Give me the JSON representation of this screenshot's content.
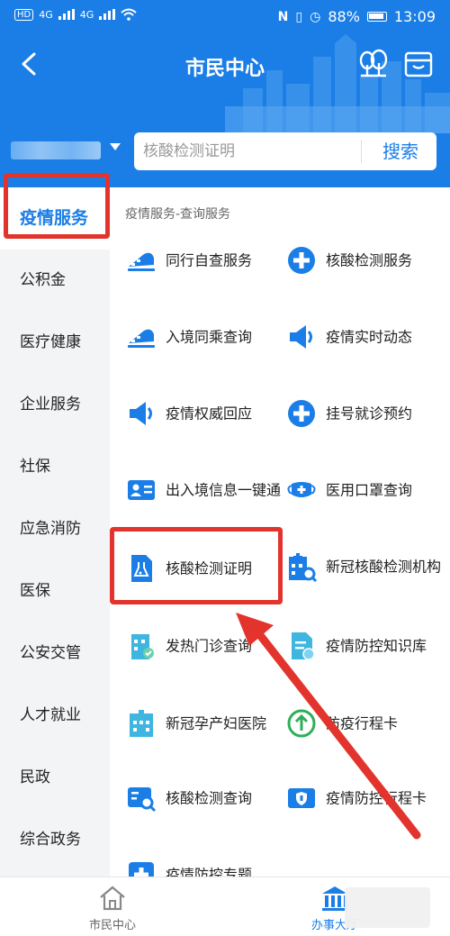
{
  "status_bar": {
    "hd_label": "HD",
    "signal_1": "4G",
    "signal_2": "4G",
    "battery": "88%",
    "time": "13:09"
  },
  "header": {
    "title": "市民中心"
  },
  "search": {
    "placeholder": "核酸检测证明",
    "button_label": "搜索"
  },
  "sidebar": {
    "items": [
      {
        "label": "疫情服务",
        "active": true
      },
      {
        "label": "公积金"
      },
      {
        "label": "医疗健康"
      },
      {
        "label": "企业服务"
      },
      {
        "label": "社保"
      },
      {
        "label": "应急消防"
      },
      {
        "label": "医保"
      },
      {
        "label": "公安交管"
      },
      {
        "label": "人才就业"
      },
      {
        "label": "民政"
      },
      {
        "label": "综合政务"
      }
    ]
  },
  "content": {
    "section_title": "疫情服务-查询服务",
    "services": [
      {
        "label": "同行自查服务",
        "icon": "train-icon"
      },
      {
        "label": "核酸检测服务",
        "icon": "plus-circle-icon"
      },
      {
        "label": "入境同乘查询",
        "icon": "train-icon"
      },
      {
        "label": "疫情实时动态",
        "icon": "speaker-icon"
      },
      {
        "label": "疫情权威回应",
        "icon": "speaker-icon"
      },
      {
        "label": "挂号就诊预约",
        "icon": "plus-circle-icon"
      },
      {
        "label": "出入境信息一键通",
        "icon": "id-card-icon"
      },
      {
        "label": "医用口罩查询",
        "icon": "mask-icon"
      },
      {
        "label": "核酸检测证明",
        "icon": "flask-document-icon",
        "highlighted": true
      },
      {
        "label": "新冠核酸检测机构",
        "icon": "hospital-search-icon"
      },
      {
        "label": "发热门诊查询",
        "icon": "hospital-icon"
      },
      {
        "label": "疫情防控知识库",
        "icon": "document-icon"
      },
      {
        "label": "新冠孕产妇医院",
        "icon": "hospital-icon"
      },
      {
        "label": "防疫行程卡",
        "icon": "arrow-up-circle-icon"
      },
      {
        "label": "核酸检测查询",
        "icon": "search-card-icon"
      },
      {
        "label": "疫情防控行程卡",
        "icon": "shield-card-icon"
      },
      {
        "label": "疫情防控专题",
        "icon": "plus-box-icon"
      }
    ]
  },
  "tabbar": {
    "items": [
      {
        "label": "市民中心",
        "icon": "home-icon"
      },
      {
        "label": "办事大厅",
        "icon": "government-building-icon",
        "active": true
      }
    ]
  },
  "colors": {
    "brand_blue": "#1b7ee6",
    "annotation_red": "#e2342c"
  }
}
